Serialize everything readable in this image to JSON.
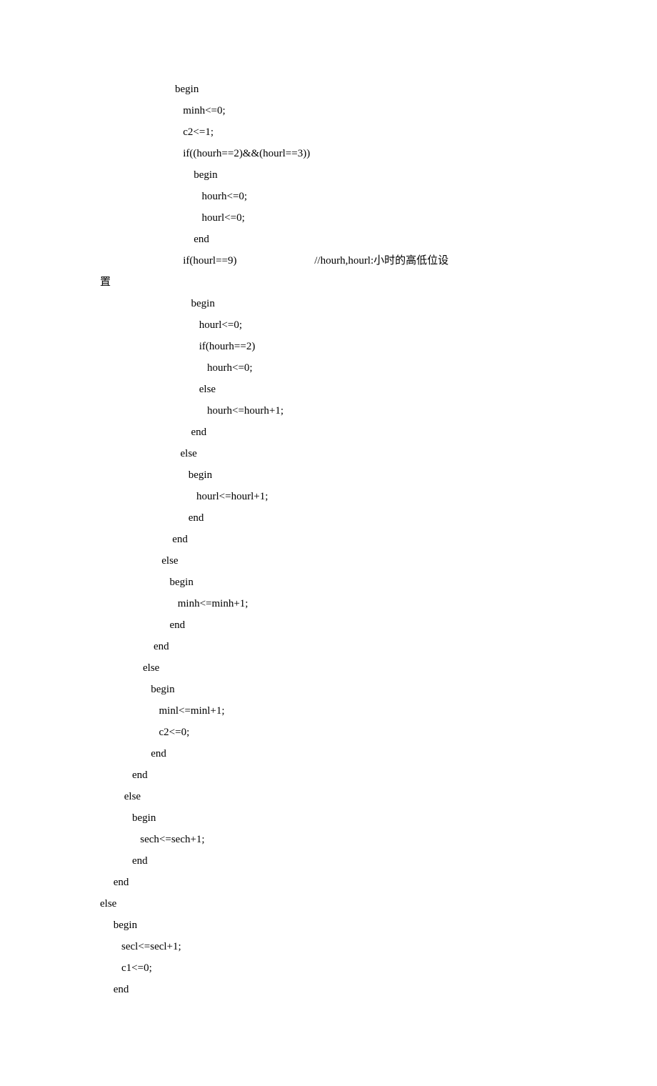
{
  "code": {
    "lines": [
      "                            begin",
      "                               minh<=0;",
      "                               c2<=1;",
      "                               if((hourh==2)&&(hourl==3))",
      "                                   begin",
      "                                      hourh<=0;",
      "                                      hourl<=0;",
      "                                   end",
      "                               if(hourl==9)                             //hourh,hourl:小时的高低位设",
      "置",
      "                                  begin",
      "                                     hourl<=0;",
      "                                     if(hourh==2)",
      "                                        hourh<=0;",
      "                                     else",
      "                                        hourh<=hourh+1;",
      "                                  end",
      "                              else",
      "                                 begin",
      "                                    hourl<=hourl+1;",
      "                                 end",
      "                           end",
      "                       else",
      "                          begin",
      "                             minh<=minh+1;",
      "                          end",
      "                    end",
      "                else",
      "                   begin",
      "                      minl<=minl+1;",
      "                      c2<=0;",
      "                   end",
      "            end",
      "         else",
      "            begin",
      "               sech<=sech+1;",
      "            end",
      "     end",
      "else",
      "     begin",
      "        secl<=secl+1;",
      "        c1<=0;",
      "     end"
    ]
  }
}
